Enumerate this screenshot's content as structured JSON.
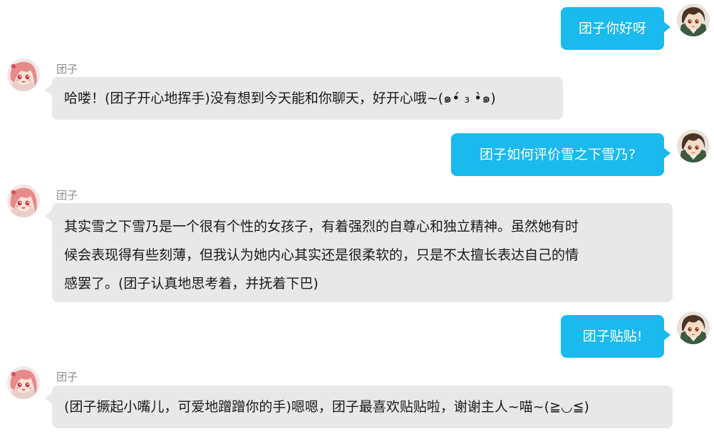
{
  "bot_name": "团子",
  "colors": {
    "user_bubble": "#1ab9ee",
    "bot_bubble": "#e8e8e8",
    "user_text": "#ffffff",
    "bot_text": "#1a1a1a"
  },
  "messages": [
    {
      "sender": "user",
      "avatar_icon": "user-avatar-icon",
      "text": "团子你好呀"
    },
    {
      "sender": "bot",
      "avatar_icon": "bot-avatar-icon",
      "name": "团子",
      "text": "哈喽！(团子开心地挥手)没有想到今天能和你聊天，好开心哦~(๑•́ ₃ •̀๑)"
    },
    {
      "sender": "user",
      "avatar_icon": "user-avatar-icon",
      "text": "团子如何评价雪之下雪乃?"
    },
    {
      "sender": "bot",
      "avatar_icon": "bot-avatar-icon",
      "name": "团子",
      "lines": [
        "其实雪之下雪乃是一个很有个性的女孩子，有着强烈的自尊心和独立精神。虽然她有时",
        "候会表现得有些刻薄，但我认为她内心其实还是很柔软的，只是不太擅长表达自己的情",
        "感罢了。(团子认真地思考着，并抚着下巴)"
      ]
    },
    {
      "sender": "user",
      "avatar_icon": "user-avatar-icon",
      "text": "团子贴贴!"
    },
    {
      "sender": "bot",
      "avatar_icon": "bot-avatar-icon",
      "name": "团子",
      "text": "(团子撅起小嘴儿，可爱地蹭蹭你的手)嗯嗯，团子最喜欢贴贴啦，谢谢主人~喵~(≧◡≦)"
    }
  ]
}
